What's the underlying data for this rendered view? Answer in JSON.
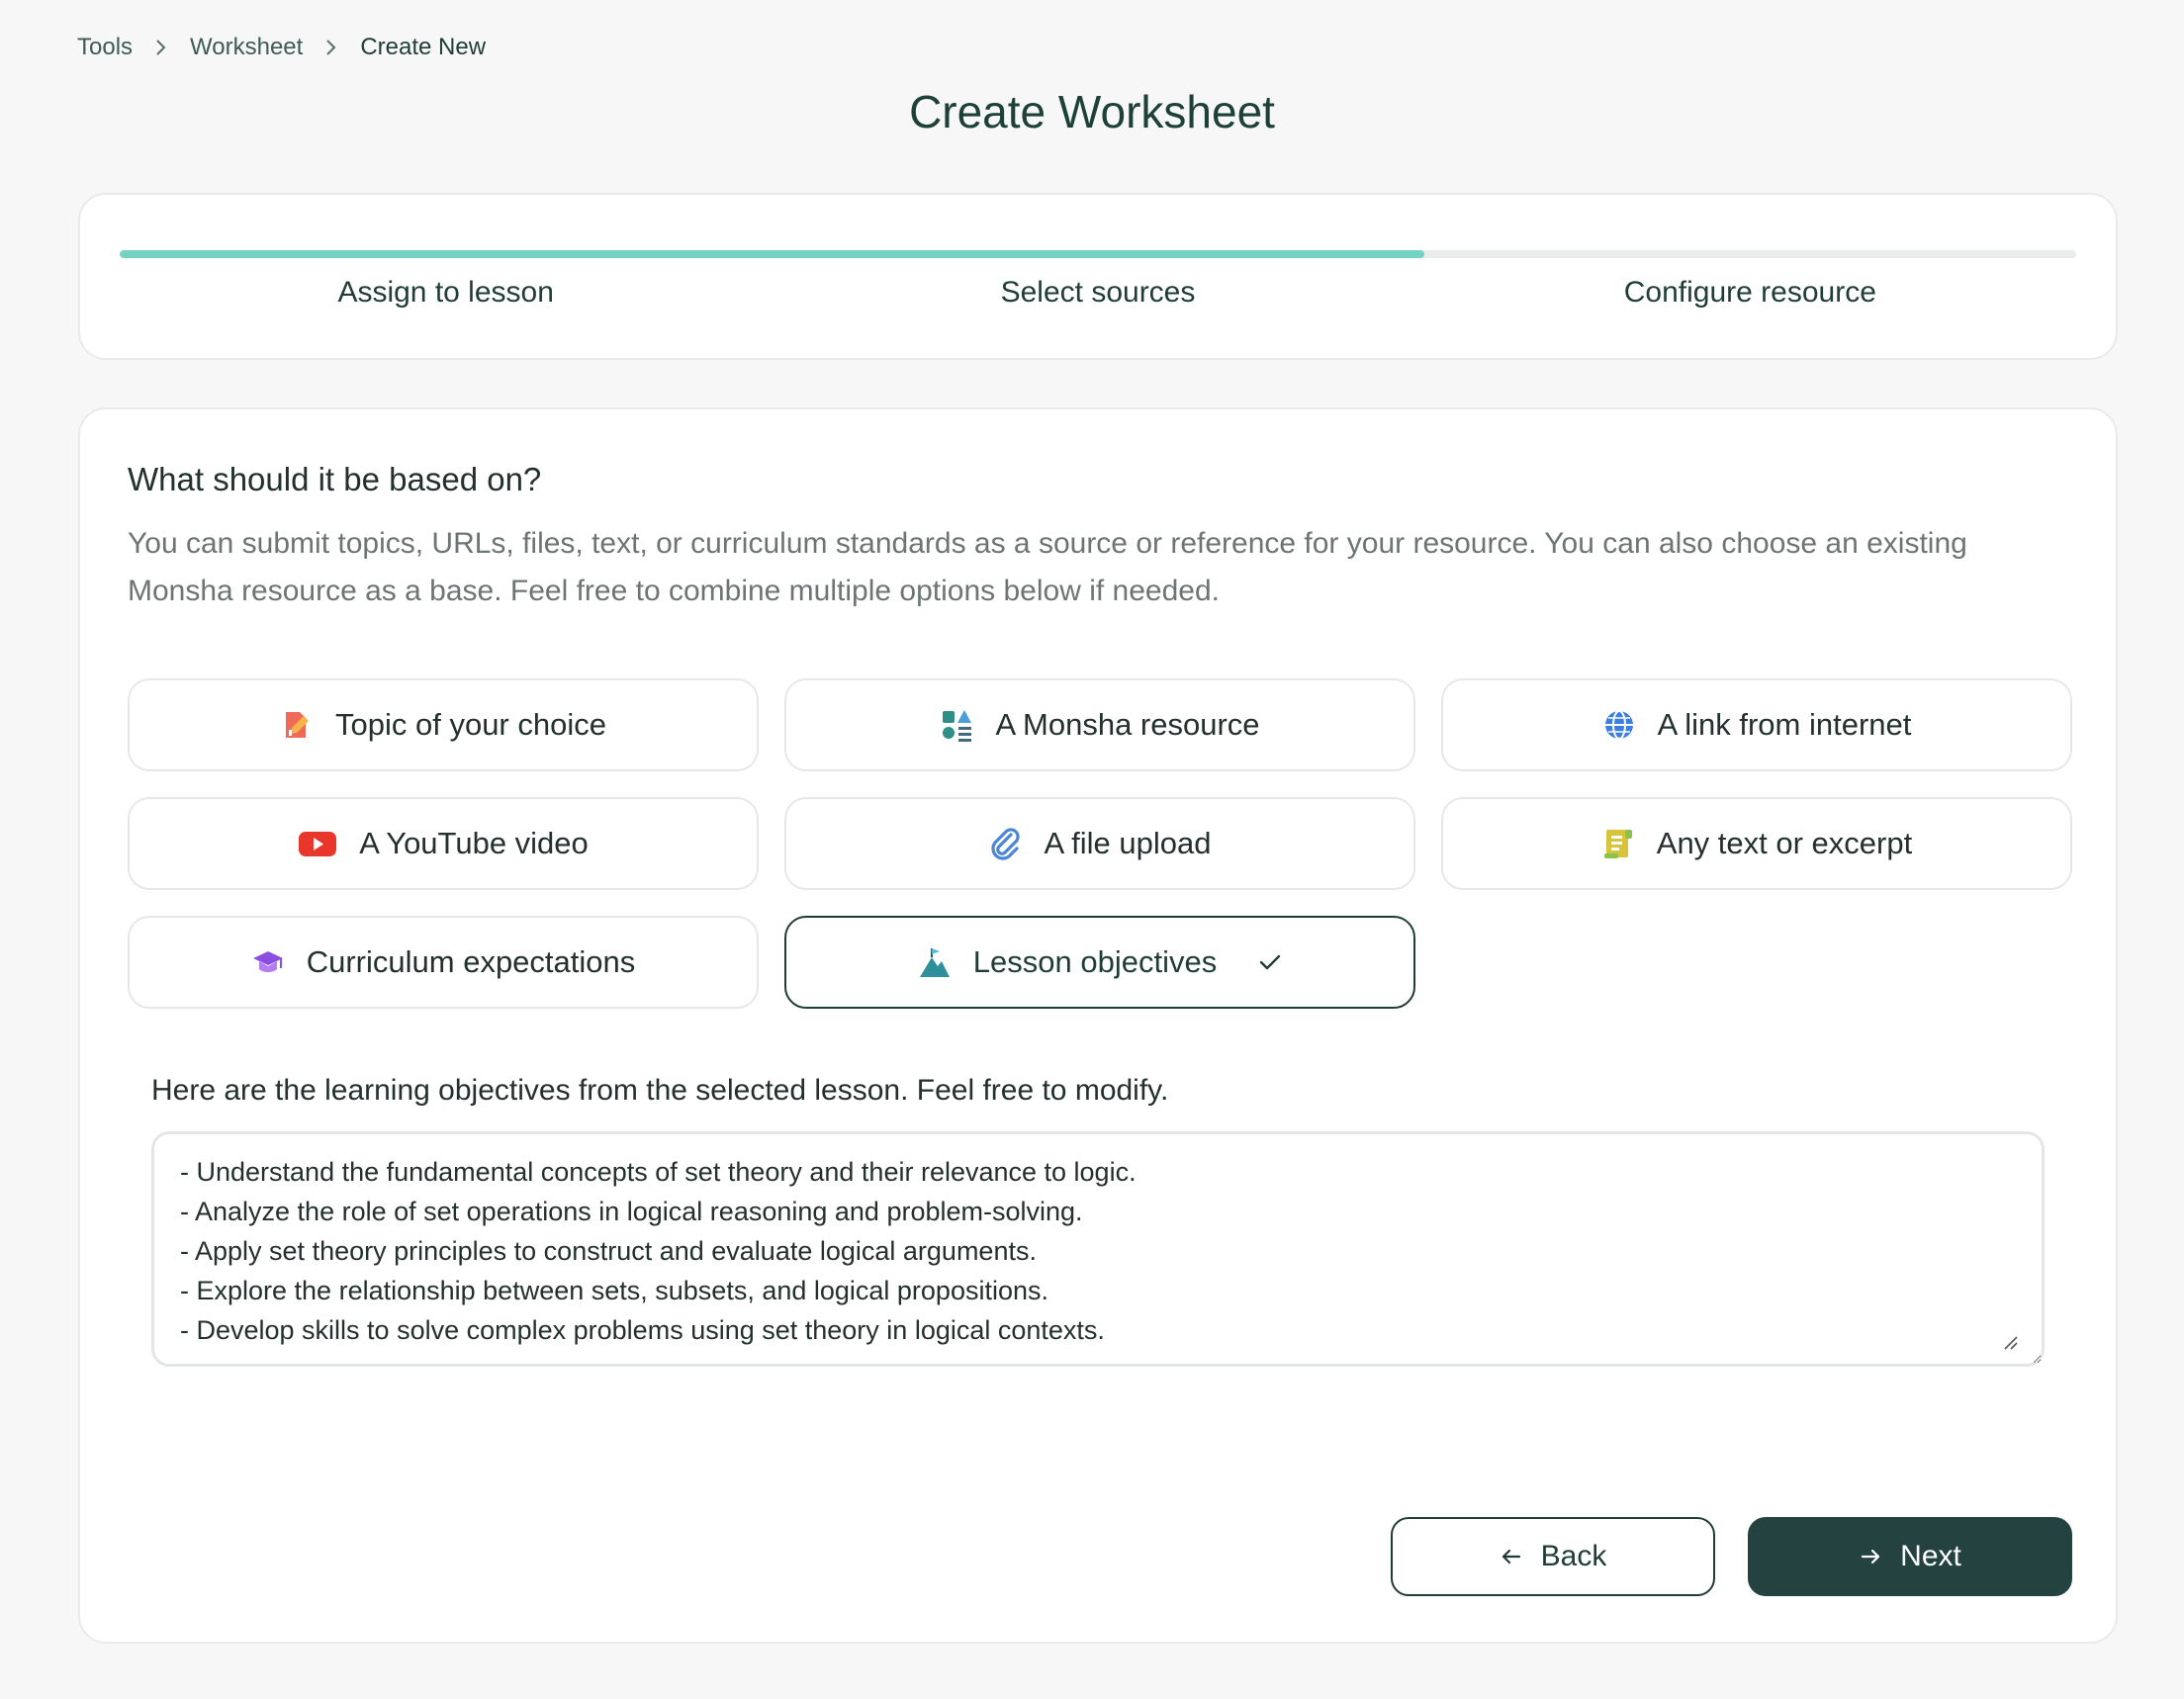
{
  "breadcrumb": {
    "items": [
      "Tools",
      "Worksheet",
      "Create New"
    ]
  },
  "page": {
    "title": "Create Worksheet"
  },
  "stepper": {
    "progress_fraction": 0.667,
    "progress_color": "#74d2c3",
    "steps": [
      "Assign to lesson",
      "Select sources",
      "Configure resource"
    ]
  },
  "sources": {
    "title": "What should it be based on?",
    "description": "You can submit topics, URLs, files, text, or curriculum standards as a source or reference for your resource. You can also choose an existing Monsha resource as a base. Feel free to combine multiple options below if needed.",
    "options": [
      {
        "label": "Topic of your choice",
        "icon": "topic-pencil-icon",
        "selected": false
      },
      {
        "label": "A Monsha resource",
        "icon": "shapes-icon",
        "selected": false
      },
      {
        "label": "A link from internet",
        "icon": "globe-icon",
        "selected": false
      },
      {
        "label": "A YouTube video",
        "icon": "youtube-icon",
        "selected": false
      },
      {
        "label": "A file upload",
        "icon": "paperclip-icon",
        "selected": false
      },
      {
        "label": "Any text or excerpt",
        "icon": "scroll-icon",
        "selected": false
      },
      {
        "label": "Curriculum expectations",
        "icon": "graduation-cap-icon",
        "selected": false
      },
      {
        "label": "Lesson objectives",
        "icon": "mountain-flag-icon",
        "selected": true
      }
    ]
  },
  "objectives": {
    "label": "Here are the learning objectives from the selected lesson. Feel free to modify.",
    "text": "- Understand the fundamental concepts of set theory and their relevance to logic.\n- Analyze the role of set operations in logical reasoning and problem-solving.\n- Apply set theory principles to construct and evaluate logical arguments.\n- Explore the relationship between sets, subsets, and logical propositions.\n- Develop skills to solve complex problems using set theory in logical contexts."
  },
  "actions": {
    "back_label": "Back",
    "next_label": "Next"
  },
  "colors": {
    "primary": "#234240",
    "accent": "#74d2c3"
  }
}
